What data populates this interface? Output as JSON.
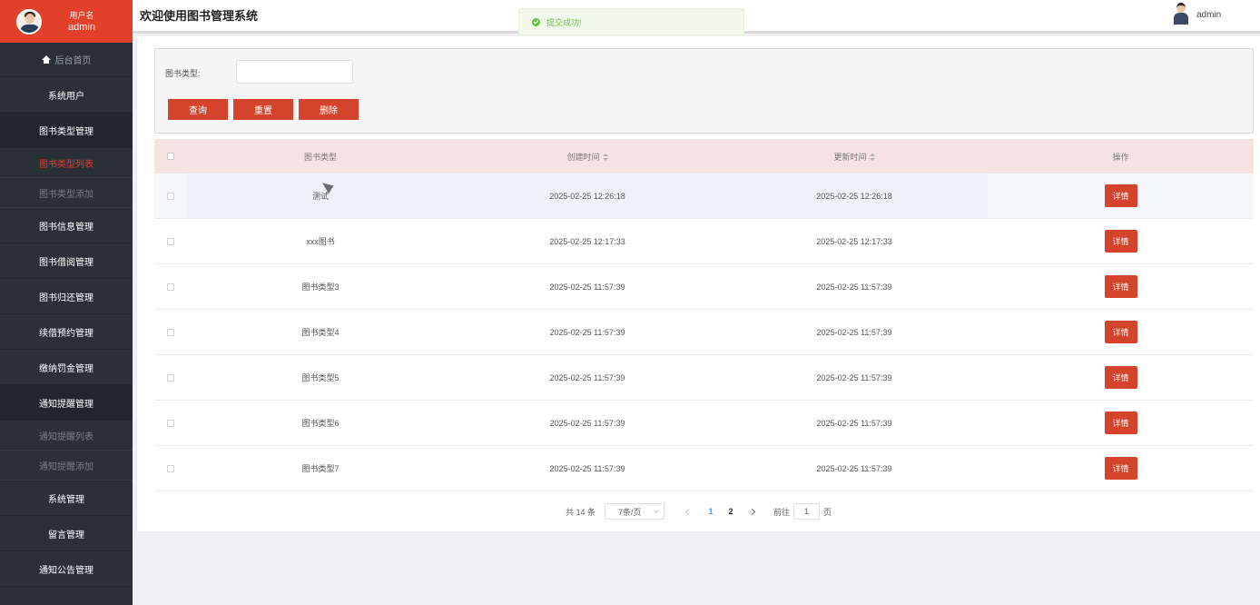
{
  "sidebar": {
    "user_role": "用户名",
    "user_name": "admin",
    "items": [
      {
        "label": "后台首页"
      },
      {
        "label": "系统用户"
      },
      {
        "label": "图书类型管理"
      },
      {
        "label": "图书类型列表"
      },
      {
        "label": "图书类型添加"
      },
      {
        "label": "图书信息管理"
      },
      {
        "label": "图书借阅管理"
      },
      {
        "label": "图书归还管理"
      },
      {
        "label": "续借预约管理"
      },
      {
        "label": "缴纳罚金管理"
      },
      {
        "label": "通知提醒管理"
      },
      {
        "label": "通知提醒列表"
      },
      {
        "label": "通知提醒添加"
      },
      {
        "label": "系统管理"
      },
      {
        "label": "留言管理"
      },
      {
        "label": "通知公告管理"
      }
    ]
  },
  "header": {
    "title": "欢迎使用图书管理系统",
    "user": "admin"
  },
  "toast": {
    "message": "提交成功!",
    "color": "#67c23a"
  },
  "search": {
    "label": "图书类型:",
    "value": "",
    "query_label": "查询",
    "reset_label": "重置",
    "delete_label": "删除"
  },
  "table": {
    "headers": {
      "type": "图书类型",
      "created": "创建时间",
      "updated": "更新时间",
      "op": "操作"
    },
    "detail_label": "详情",
    "rows": [
      {
        "type": "测试",
        "created": "2025-02-25 12:26:18",
        "updated": "2025-02-25 12:26:18"
      },
      {
        "type": "xxx图书",
        "created": "2025-02-25 12:17:33",
        "updated": "2025-02-25 12:17:33"
      },
      {
        "type": "图书类型3",
        "created": "2025-02-25 11:57:39",
        "updated": "2025-02-25 11:57:39"
      },
      {
        "type": "图书类型4",
        "created": "2025-02-25 11:57:39",
        "updated": "2025-02-25 11:57:39"
      },
      {
        "type": "图书类型5",
        "created": "2025-02-25 11:57:39",
        "updated": "2025-02-25 11:57:39"
      },
      {
        "type": "图书类型6",
        "created": "2025-02-25 11:57:39",
        "updated": "2025-02-25 11:57:39"
      },
      {
        "type": "图书类型7",
        "created": "2025-02-25 11:57:39",
        "updated": "2025-02-25 11:57:39"
      }
    ]
  },
  "pagination": {
    "total": "共 14 条",
    "page_size": "7条/页",
    "pages": [
      "1",
      "2"
    ],
    "current_page": "1",
    "goto_label": "前往",
    "goto_value": "1",
    "page_suffix": "页"
  },
  "colors": {
    "accent": "#d4432c",
    "sidebar": "#2b2f37",
    "brand": "#e2402b"
  }
}
